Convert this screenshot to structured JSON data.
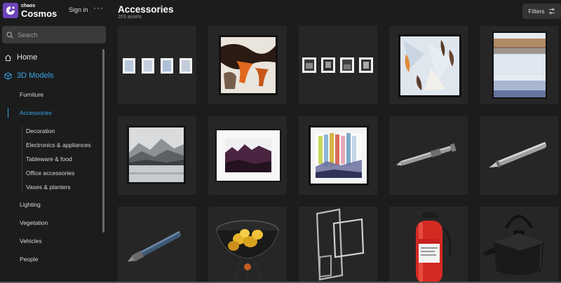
{
  "app": {
    "brand_small": "chaos",
    "brand_name": "Cosmos",
    "signin_label": "Sign in",
    "more_label": "···"
  },
  "search": {
    "placeholder": "Search"
  },
  "nav": {
    "home": "Home",
    "models": "3D Models",
    "categories": [
      "Furniture",
      "Accessories",
      "Lighting",
      "Vegetation",
      "Vehicles",
      "People"
    ],
    "subcategories": [
      "Decoration",
      "Electronics & appliances",
      "Tableware & food",
      "Office accessories",
      "Vases & planters"
    ]
  },
  "page": {
    "title": "Accessories",
    "count": "203 assets",
    "filters_label": "Filters"
  },
  "colors": {
    "accent": "#38a6e8",
    "brand": "#6d44b8",
    "background": "#1c1c1c",
    "tile": "#262626"
  },
  "icons": {
    "home": "home-icon",
    "models": "cube-icon",
    "search": "search-icon",
    "filters": "sliders-icon"
  }
}
